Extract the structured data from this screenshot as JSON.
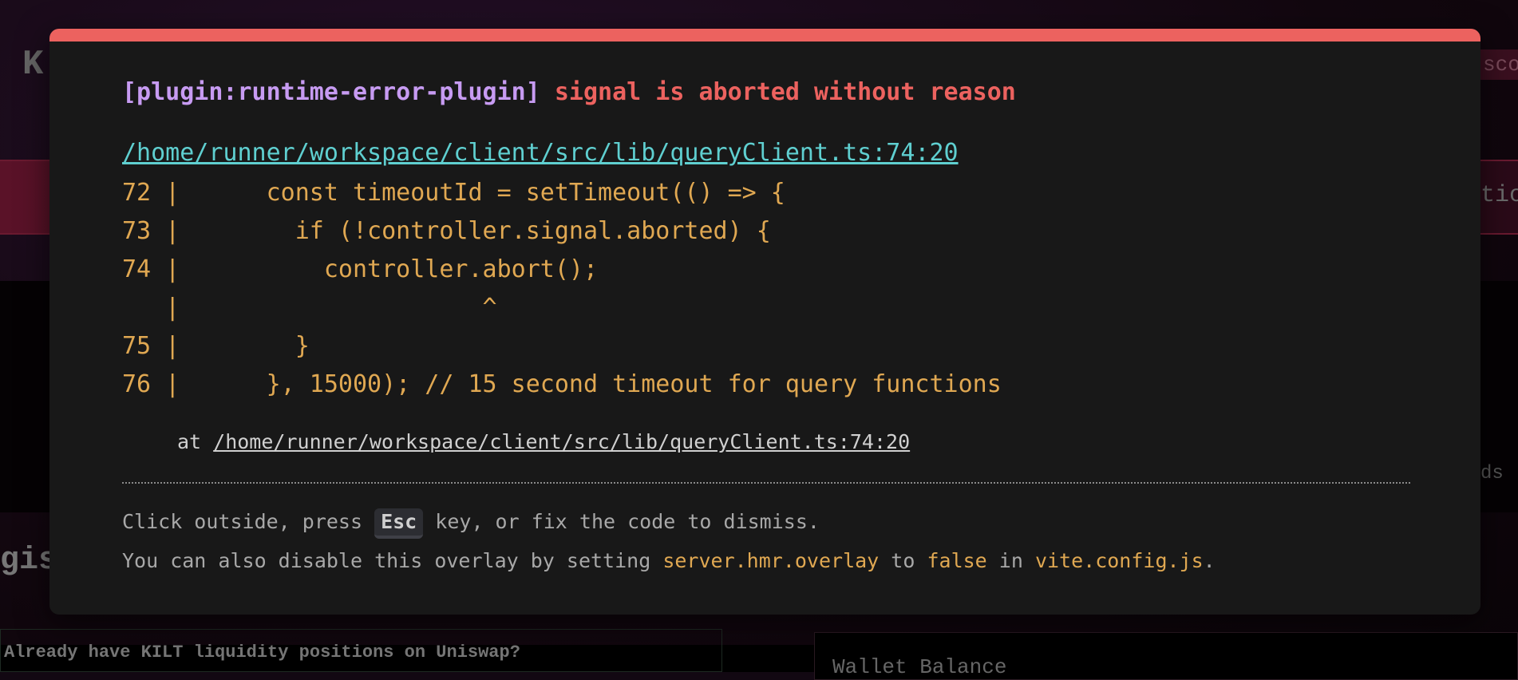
{
  "background": {
    "logo_letter": "K",
    "header_fragment": "sco",
    "tab_fragment": "tio",
    "card_fragment": "ds",
    "section_fragment": "gis",
    "positions_prompt": "Already have KILT liquidity positions on Uniswap?",
    "wallet_balance_label": "Wallet Balance"
  },
  "overlay": {
    "plugin": "[plugin:runtime-error-plugin]",
    "message": "signal is aborted without reason",
    "file_link": "/home/runner/workspace/client/src/lib/queryClient.ts:74:20",
    "code_frame": [
      "72 |      const timeoutId = setTimeout(() => {",
      "73 |        if (!controller.signal.aborted) {",
      "74 |          controller.abort();",
      "   |                     ^",
      "75 |        }",
      "76 |      }, 15000); // 15 second timeout for query functions"
    ],
    "stack_prefix": "at ",
    "stack_link": "/home/runner/workspace/client/src/lib/queryClient.ts:74:20",
    "tip1_before": "Click outside, press ",
    "tip1_key": "Esc",
    "tip1_after": " key, or fix the code to dismiss.",
    "tip2_a": "You can also disable this overlay by setting ",
    "tip2_setting": "server.hmr.overlay",
    "tip2_b": " to ",
    "tip2_value": "false",
    "tip2_c": " in ",
    "tip2_file": "vite.config.js",
    "tip2_d": "."
  },
  "colors": {
    "accent": "#ec625f",
    "plugin": "#c79bf2",
    "link": "#5fcfd0",
    "code": "#e0a852"
  }
}
